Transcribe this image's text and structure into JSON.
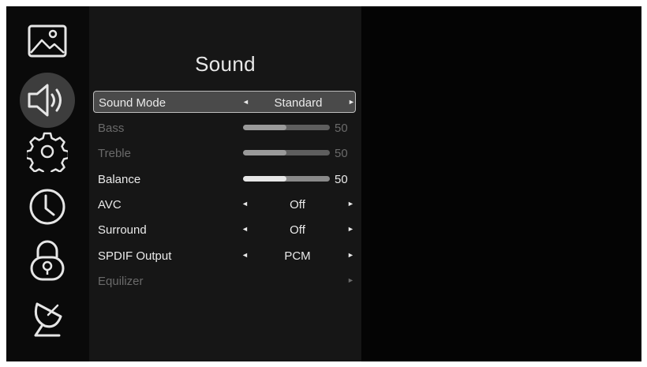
{
  "sidebar": {
    "items": [
      {
        "icon": "picture-icon"
      },
      {
        "icon": "sound-icon",
        "active": true
      },
      {
        "icon": "settings-gear-icon"
      },
      {
        "icon": "clock-icon"
      },
      {
        "icon": "lock-icon"
      },
      {
        "icon": "satellite-dish-icon"
      }
    ]
  },
  "panel": {
    "title": "Sound",
    "rows": {
      "sound_mode": {
        "label": "Sound Mode",
        "value": "Standard",
        "arrow_left": "◄",
        "arrow_right": "►"
      },
      "bass": {
        "label": "Bass",
        "value": "50",
        "level": 0.5
      },
      "treble": {
        "label": "Treble",
        "value": "50",
        "level": 0.5
      },
      "balance": {
        "label": "Balance",
        "value": "50",
        "level": 0.5
      },
      "avc": {
        "label": "AVC",
        "value": "Off",
        "arrow_left": "◄",
        "arrow_right": "►"
      },
      "surround": {
        "label": "Surround",
        "value": "Off",
        "arrow_left": "◄",
        "arrow_right": "►"
      },
      "spdif_output": {
        "label": "SPDIF Output",
        "value": "PCM",
        "arrow_left": "◄",
        "arrow_right": "►"
      },
      "equilizer": {
        "label": "Equilizer",
        "arrow_right": "►"
      }
    }
  },
  "colors": {
    "background": "#040404",
    "panel": "#161616",
    "selected_row": "#4a4a4a",
    "active_icon_bubble": "#3d3d3d"
  }
}
